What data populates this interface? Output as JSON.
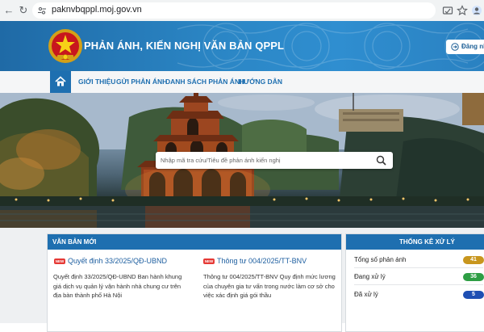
{
  "browser": {
    "url": "paknvbqppl.moj.gov.vn"
  },
  "header": {
    "site_title": "PHẢN ÁNH, KIẾN NGHỊ VĂN BẢN QPPL",
    "login_label": "Đăng nh"
  },
  "nav": {
    "items": [
      {
        "label": "GIỚI THIỆU"
      },
      {
        "label": "GỬI PHẢN ÁNH"
      },
      {
        "label": "DANH SÁCH PHẢN ÁNH"
      },
      {
        "label": "HƯỚNG DẪN"
      }
    ]
  },
  "search": {
    "placeholder": "Nhập mã tra cứu/Tiêu đề phản ánh kiến nghị"
  },
  "new_docs": {
    "heading": "VĂN BẢN MỚI",
    "badge": "NEW",
    "items": [
      {
        "title": "Quyết định 33/2025/QĐ-UBND",
        "desc_lines": [
          "Quyết định 33/2025/QĐ-UBND Ban hành khung",
          "giá dịch vụ quản lý vận hành nhà chung cư trên",
          "địa bàn thành phố Hà Nội"
        ]
      },
      {
        "title": "Thông tư 004/2025/TT-BNV",
        "desc_lines": [
          "Thông tư 004/2025/TT-BNV Quy định mức lương",
          "của chuyên gia tư vấn trong nước làm cơ sở cho",
          "việc xác định giá gói thầu"
        ]
      }
    ]
  },
  "stats": {
    "heading": "THỐNG KÊ XỬ LÝ",
    "rows": [
      {
        "label": "Tổng số phản ánh",
        "value": "41",
        "color": "#c8961e"
      },
      {
        "label": "Đang xử lý",
        "value": "36",
        "color": "#2e9e44"
      },
      {
        "label": "Đã xử lý",
        "value": "5",
        "color": "#1e4fb3"
      }
    ]
  },
  "colors": {
    "primary": "#1e6fb0",
    "badge_new": "#e53935"
  }
}
